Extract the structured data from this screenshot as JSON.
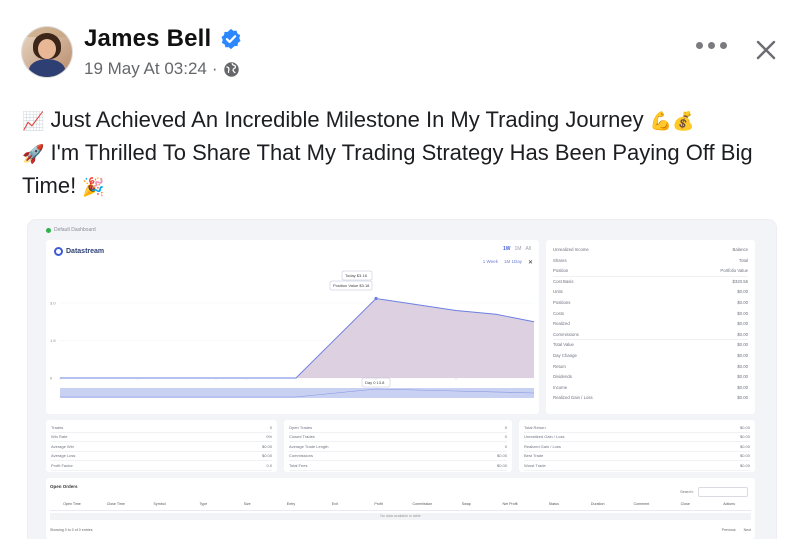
{
  "post": {
    "author": "James Bell",
    "date": "19 May At 03:24",
    "date_sep": "·",
    "line1_emoji": "📈",
    "line1": " Just Achieved An Incredible Milestone In My Trading Journey ",
    "line1_end_emoji": "💪💰",
    "line2_emoji": "🚀",
    "line2": " I'm Thrilled To Share That My Trading Strategy Has Been Paying Off Big Time! ",
    "line2_end_emoji": "🎉"
  },
  "icons": {
    "verified": "verified-badge-icon",
    "audience": "globe-icon",
    "more": "more-options-icon",
    "close": "close-icon"
  },
  "colors": {
    "verified": "#2d88ff",
    "chart_fill": "#ddd0e0",
    "chart_line": "#6b7fe0",
    "accent": "#3d5bd9"
  },
  "embedded": {
    "tab_label": "Default Dashboard",
    "brand": "Datastream",
    "range_tabs": [
      "1W",
      "1M",
      "All"
    ],
    "chips": [
      "1 Week",
      "1M 1Day"
    ],
    "chips_close": "✕",
    "tooltip_top": "Today $3.18",
    "tooltip_mid": "Position Value $3.18",
    "tooltip_bottom": "Day 0 13.8",
    "side_rows": [
      [
        "Unrealized Income",
        "Balance"
      ],
      [
        "Shares",
        "Total"
      ],
      [
        "Position",
        "Portfolio Value"
      ],
      [
        "Cost Basis",
        "$320.56"
      ],
      [
        "Units",
        "$0.00"
      ],
      [
        "Positions",
        "$0.00"
      ],
      [
        "Costs",
        "$0.00"
      ],
      [
        "Realized",
        "$0.00"
      ],
      [
        "Commissions",
        "$0.00"
      ],
      [
        "Total Value",
        "$0.00"
      ],
      [
        "Day Change",
        "$0.00"
      ],
      [
        "Return",
        "$0.00"
      ],
      [
        "Dividends",
        "$0.00"
      ],
      [
        "Income",
        "$0.00"
      ],
      [
        "Realized Gain / Loss",
        "$0.00"
      ]
    ],
    "stat_col1": [
      [
        "Trades",
        "0"
      ],
      [
        "Win Rate",
        "0%"
      ],
      [
        "Average Win",
        "$0.00"
      ],
      [
        "Average Loss",
        "$0.00"
      ],
      [
        "Profit Factor",
        "0.0"
      ]
    ],
    "stat_col2": [
      [
        "Open Trades",
        "0"
      ],
      [
        "Closed Trades",
        "0"
      ],
      [
        "Average Trade Length",
        "0"
      ],
      [
        "Commissions",
        "$0.00"
      ],
      [
        "Total Fees",
        "$0.00"
      ]
    ],
    "stat_col3": [
      [
        "Total Return",
        "$0.00"
      ],
      [
        "Unrealized Gain / Loss",
        "$0.00"
      ],
      [
        "Realized Gain / Loss",
        "$0.00"
      ],
      [
        "Best Trade",
        "$0.00"
      ],
      [
        "Worst Trade",
        "$0.00"
      ]
    ],
    "orders_title": "Open Orders",
    "search_label": "Search:",
    "columns": [
      "Open Time",
      "Close Time",
      "Symbol",
      "Type",
      "Size",
      "Entry",
      "Exit",
      "Profit",
      "Commission",
      "Swap",
      "Net Profit",
      "Status",
      "Duration",
      "Comment",
      "Close",
      "Actions"
    ],
    "empty_text": "No data available in table",
    "footer_left": "Showing 0 to 0 of 0 entries",
    "footer_prev": "Previous",
    "footer_next": "Next"
  },
  "chart_data": {
    "type": "area",
    "x": [
      "",
      "",
      "",
      "",
      "",
      "",
      "",
      "",
      "",
      ""
    ],
    "values": [
      0,
      0,
      0,
      0,
      0,
      0,
      3.18,
      2.7,
      2.55,
      2.25
    ],
    "ylim": [
      0,
      4
    ],
    "ytick_labels": [
      "0",
      "1.5",
      "3.0"
    ],
    "title": "",
    "xlabel": "",
    "ylabel": ""
  }
}
